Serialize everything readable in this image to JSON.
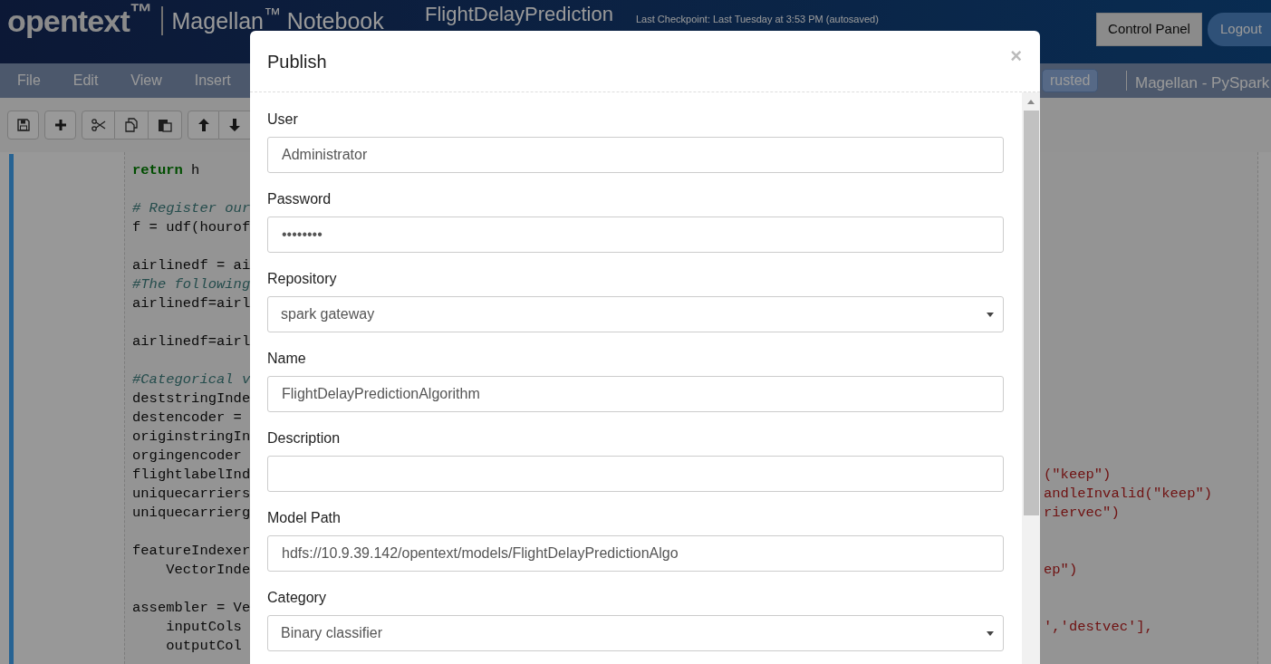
{
  "header": {
    "logo_brand": "opentext$^{™}$",
    "logo_product": "Magellan$^{™}$ Notebook",
    "notebook_title": "FlightDelayPrediction",
    "checkpoint": "Last Checkpoint: Last Tuesday at 3:53 PM (autosaved)",
    "buttons": [
      {
        "label": "Control Panel",
        "kind": "square"
      },
      {
        "label": "Logout",
        "kind": "pill"
      }
    ]
  },
  "menu": [
    "File",
    "Edit",
    "View",
    "Insert"
  ],
  "trusted_badge": "rusted",
  "kernel": "Magellan - PySpark",
  "code_lines": [
    {
      "kind": "code",
      "left": "**return** h"
    },
    {
      "kind": "blank"
    },
    {
      "kind": "comment",
      "left": "# Register our"
    },
    {
      "kind": "code",
      "left": "f = udf(hourof"
    },
    {
      "kind": "blank"
    },
    {
      "kind": "code",
      "left": "airlinedf = ai"
    },
    {
      "kind": "comment",
      "left": "#The following"
    },
    {
      "kind": "code",
      "left": "airlinedf=airl"
    },
    {
      "kind": "blank"
    },
    {
      "kind": "code",
      "left": "airlinedf=airl"
    },
    {
      "kind": "blank"
    },
    {
      "kind": "comment",
      "left": "#Categorical v"
    },
    {
      "kind": "code",
      "left": "deststringInde"
    },
    {
      "kind": "code",
      "left": "destencoder ="
    },
    {
      "kind": "code",
      "left": "originstringIn"
    },
    {
      "kind": "code",
      "left": "orgingencoder"
    },
    {
      "kind": "code",
      "left": "flightlabelInd",
      "right": "(\"keep\")"
    },
    {
      "kind": "code",
      "left": "uniquecarriers",
      "right": "andleInvalid(\"keep\")"
    },
    {
      "kind": "code",
      "left": "uniquecarrierg",
      "right": "riervec\")"
    },
    {
      "kind": "blank"
    },
    {
      "kind": "code",
      "left": "featureIndexer"
    },
    {
      "kind": "code",
      "left": "    VectorInde",
      "right": "ep\")"
    },
    {
      "kind": "blank"
    },
    {
      "kind": "code",
      "left": "assembler = Ve"
    },
    {
      "kind": "code",
      "left": "    inputCols",
      "right": "','destvec'],"
    },
    {
      "kind": "code",
      "left": "    outputCol"
    }
  ],
  "dialog": {
    "title": "Publish",
    "close": "×",
    "fields": [
      {
        "label": "User",
        "kind": "text",
        "value": "Administrator"
      },
      {
        "label": "Password",
        "kind": "password",
        "value": "••••••••"
      },
      {
        "label": "Repository",
        "kind": "select",
        "value": "spark gateway"
      },
      {
        "label": "Name",
        "kind": "text",
        "value": "FlightDelayPredictionAlgorithm"
      },
      {
        "label": "Description",
        "kind": "text"
      },
      {
        "label": "Model Path",
        "kind": "text",
        "value": "hdfs://10.9.39.142/opentext/models/FlightDelayPredictionAlgo"
      },
      {
        "label": "Category",
        "kind": "select",
        "value": "Binary classifier"
      }
    ]
  }
}
